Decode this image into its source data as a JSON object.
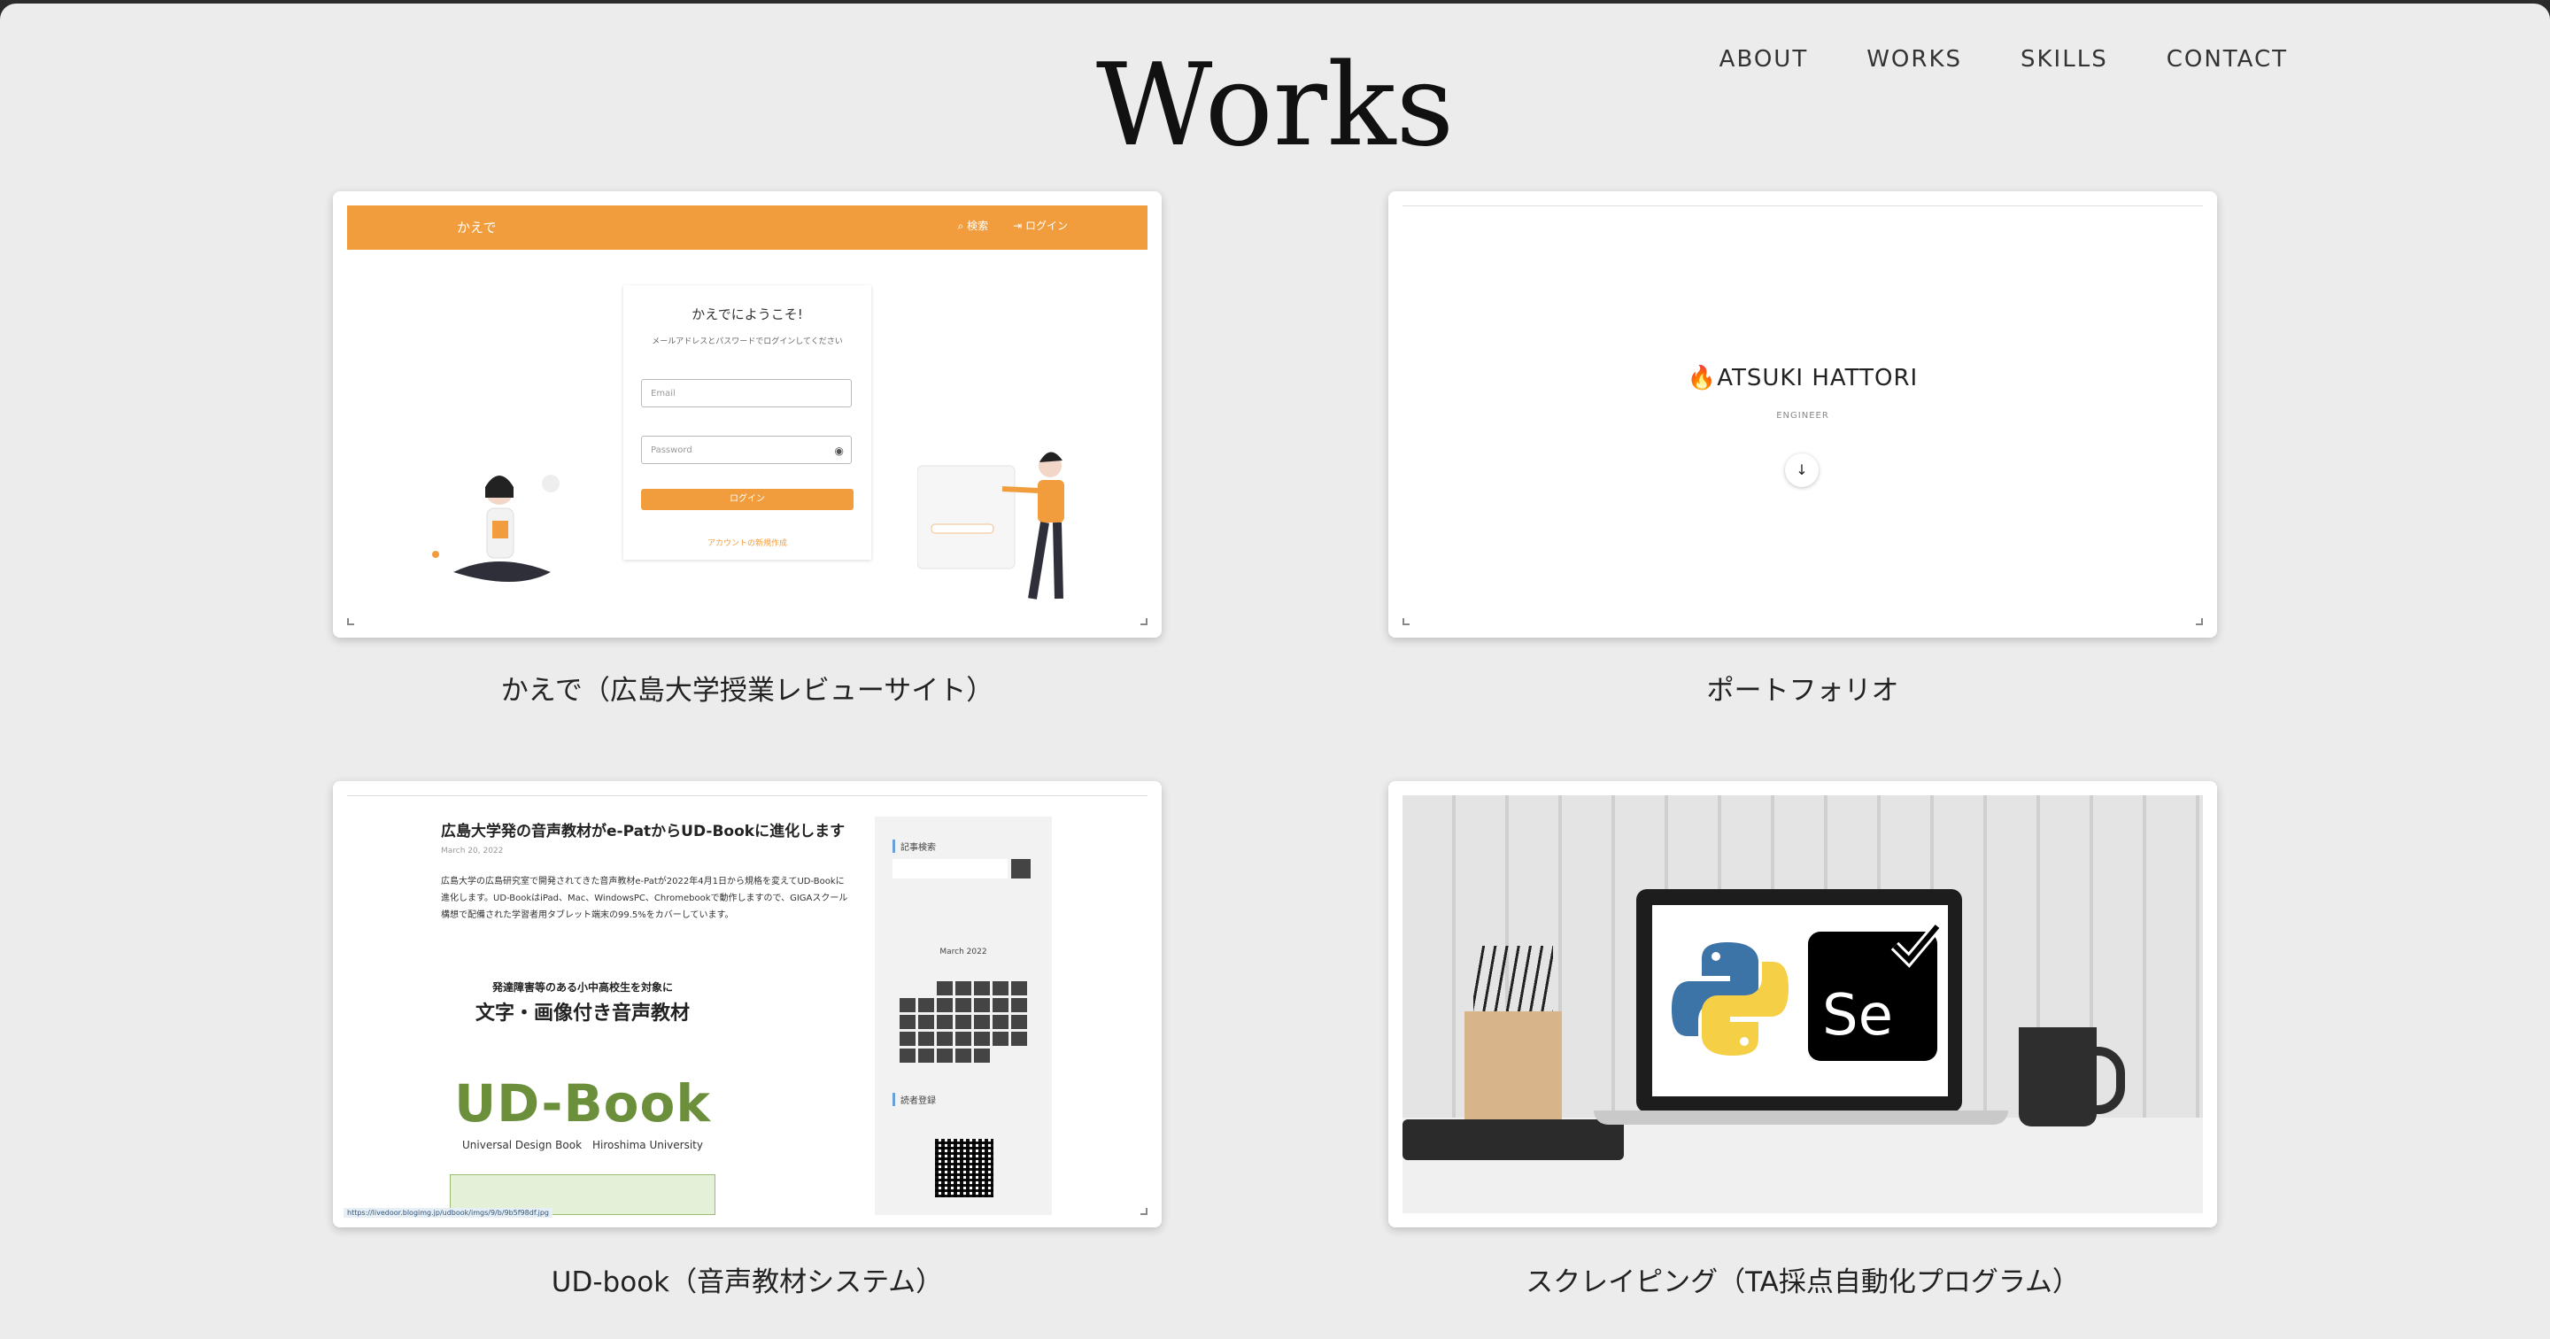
{
  "nav": {
    "about": "ABOUT",
    "works": "WORKS",
    "skills": "SKILLS",
    "contact": "CONTACT"
  },
  "page_title": "Works",
  "works": [
    {
      "caption": "かえで（広島大学授業レビューサイト）",
      "preview": {
        "app_name": "かえで",
        "search": "検索",
        "login_link": "ログイン",
        "heading": "かえでにようこそ!",
        "subheading": "メールアドレスとパスワードでログインしてください",
        "email_placeholder": "Email",
        "password_placeholder": "Password",
        "login_button": "ログイン",
        "register_link": "アカウントの新規作成",
        "accent_color": "#f29d3d"
      }
    },
    {
      "caption": "ポートフォリオ",
      "preview": {
        "name": "ATSUKI HATTORI",
        "role": "ENGINEER"
      }
    },
    {
      "caption": "UD-book（音声教材システム）",
      "preview": {
        "article_title": "広島大学発の音声教材がe-PatからUD-Bookに進化します",
        "date": "March 20, 2022",
        "body": "広島大学の広島研究室で開発されてきた音声教材e-Patが2022年4月1日から規格を変えてUD-Bookに進化します。UD-BookはiPad、Mac、WindowsPC、Chromebookで動作しますので、GIGAスクール構想で配備された学習者用タブレット端末の99.5%をカバーしています。",
        "poster_heading": "発達障害等のある小中高校生を対象に",
        "poster_title": "文字・画像付き音声教材",
        "poster_logo": "UD-Book",
        "poster_logo_sub": "Universal Design Book　Hiroshima University",
        "sidebar_search_label": "記事検索",
        "calendar_title": "March 2022",
        "sidebar_reader_label": "読者登録",
        "status_url": "https://livedoor.blogimg.jp/udbook/imgs/9/b/9b5f98df.jpg"
      }
    },
    {
      "caption": "スクレイピング（TA採点自動化プログラム）",
      "preview": {
        "selenium_label": "Se"
      }
    }
  ]
}
